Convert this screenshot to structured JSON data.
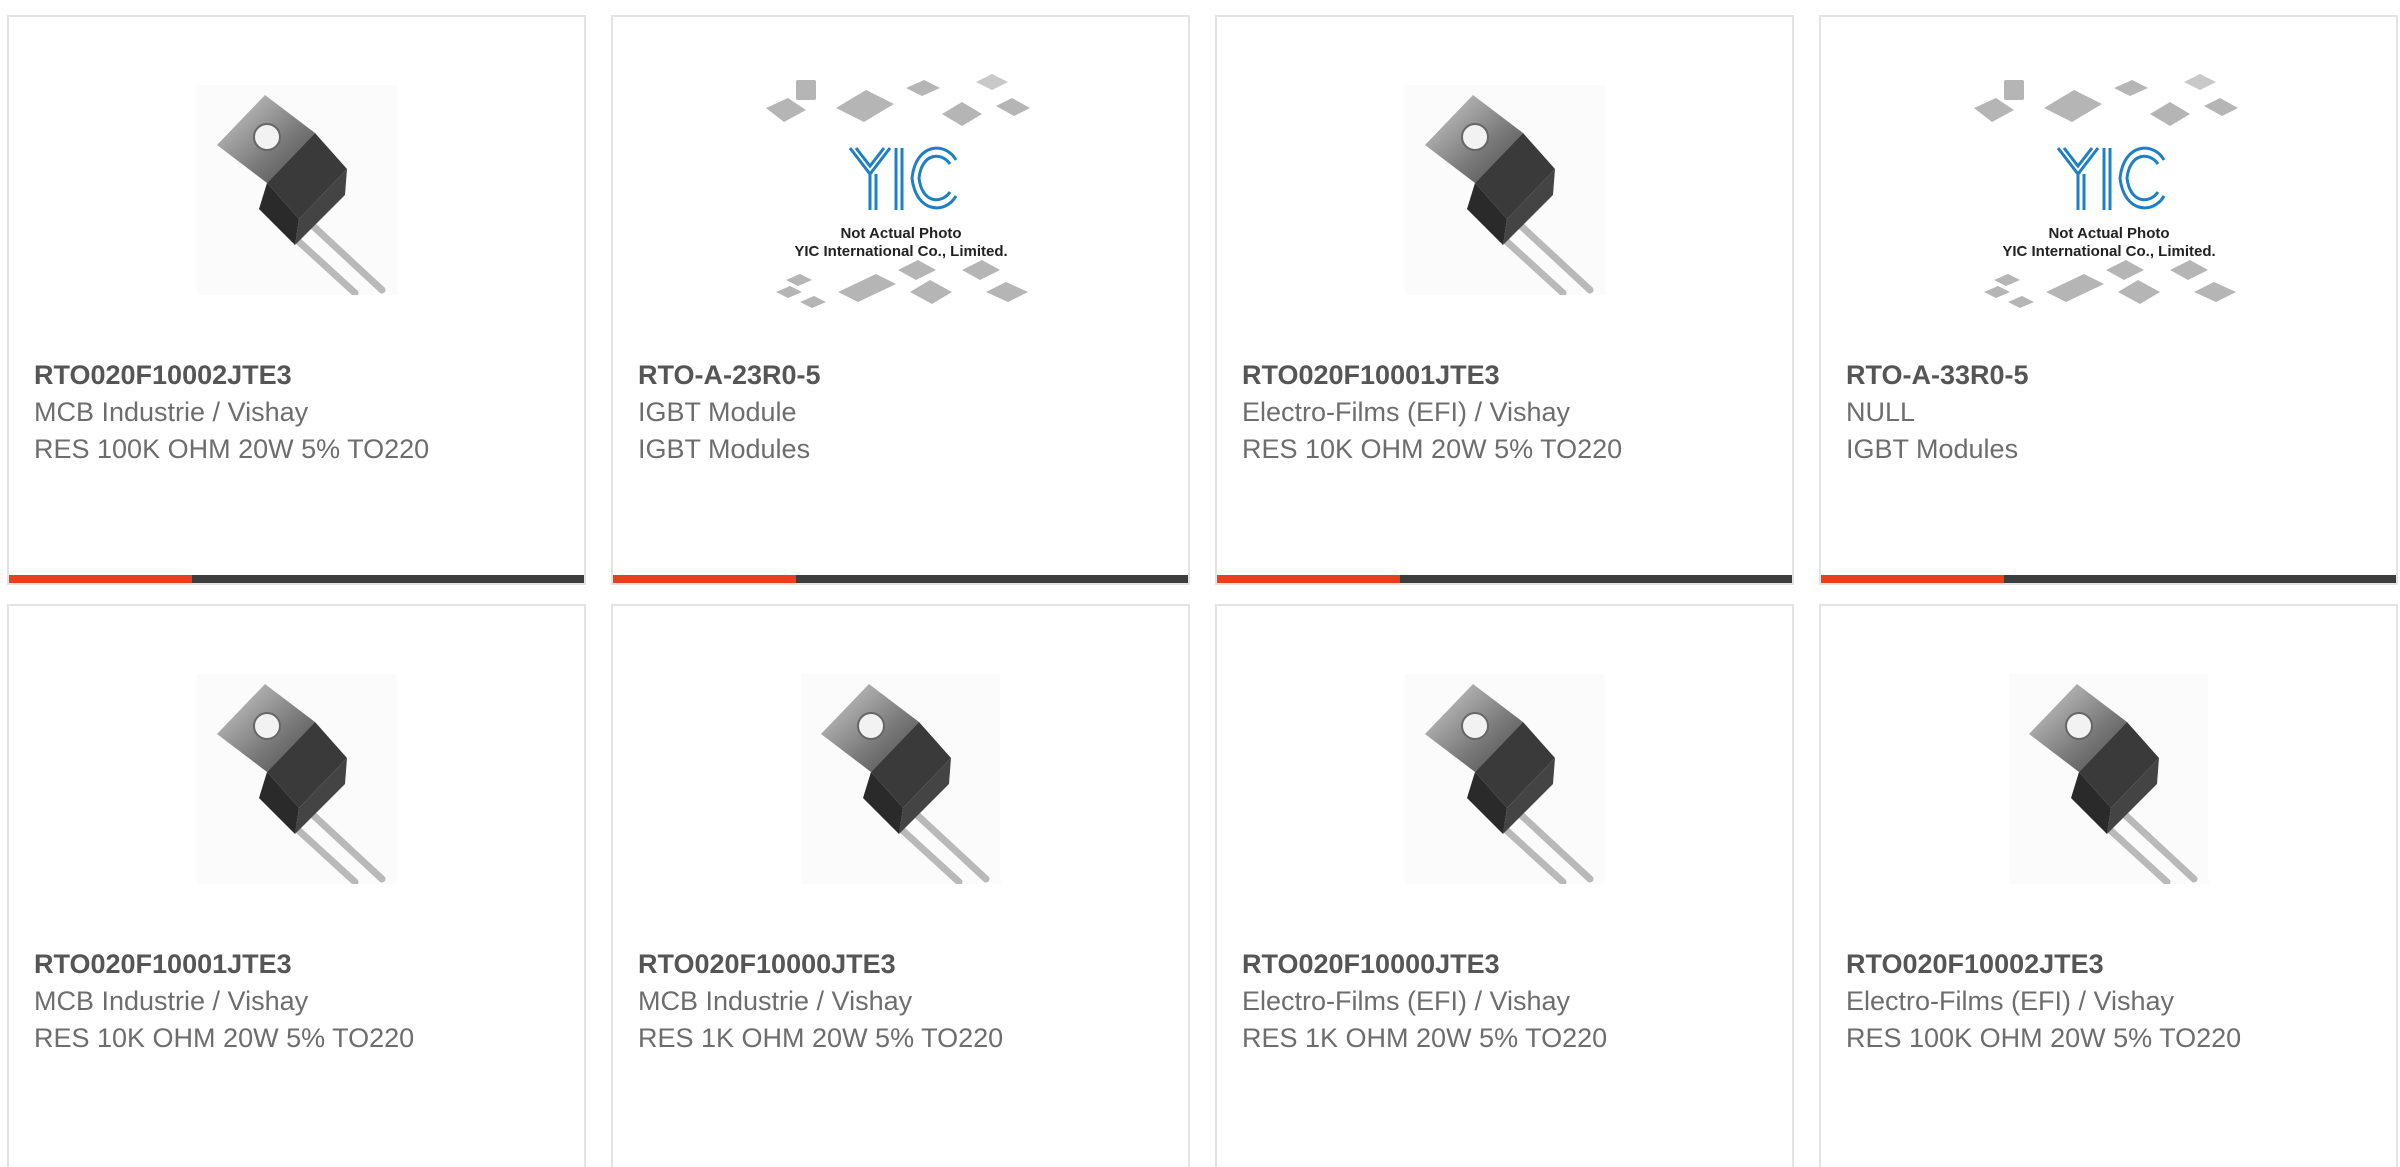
{
  "products": [
    {
      "part_number": "RTO020F10002JTE3",
      "manufacturer": "MCB Industrie / Vishay",
      "description": "RES 100K OHM 20W 5% TO220",
      "image": "to220-resistor-photo"
    },
    {
      "part_number": "RTO-A-23R0-5",
      "manufacturer": "IGBT Module",
      "description": "IGBT Modules",
      "image": "yic-placeholder",
      "placeholder_line1": "Not Actual Photo",
      "placeholder_line2": "YIC International Co., Limited.",
      "placeholder_logo": "YIC"
    },
    {
      "part_number": "RTO020F10001JTE3",
      "manufacturer": "Electro-Films (EFI) / Vishay",
      "description": "RES 10K OHM 20W 5% TO220",
      "image": "to220-resistor-photo"
    },
    {
      "part_number": "RTO-A-33R0-5",
      "manufacturer": "NULL",
      "description": "IGBT Modules",
      "image": "yic-placeholder",
      "placeholder_line1": "Not Actual Photo",
      "placeholder_line2": "YIC International Co., Limited.",
      "placeholder_logo": "YIC"
    },
    {
      "part_number": "RTO020F10001JTE3",
      "manufacturer": "MCB Industrie / Vishay",
      "description": "RES 10K OHM 20W 5% TO220",
      "image": "to220-resistor-photo"
    },
    {
      "part_number": "RTO020F10000JTE3",
      "manufacturer": "MCB Industrie / Vishay",
      "description": "RES 1K OHM 20W 5% TO220",
      "image": "to220-resistor-photo"
    },
    {
      "part_number": "RTO020F10000JTE3",
      "manufacturer": "Electro-Films (EFI) / Vishay",
      "description": "RES 1K OHM 20W 5% TO220",
      "image": "to220-resistor-photo"
    },
    {
      "part_number": "RTO020F10002JTE3",
      "manufacturer": "Electro-Films (EFI) / Vishay",
      "description": "RES 100K OHM 20W 5% TO220",
      "image": "to220-resistor-photo"
    }
  ],
  "colors": {
    "accent": "#e8401b",
    "bar": "#3d3d3d",
    "border": "#e3e3e3",
    "logo_blue": "#1f7fc4"
  }
}
